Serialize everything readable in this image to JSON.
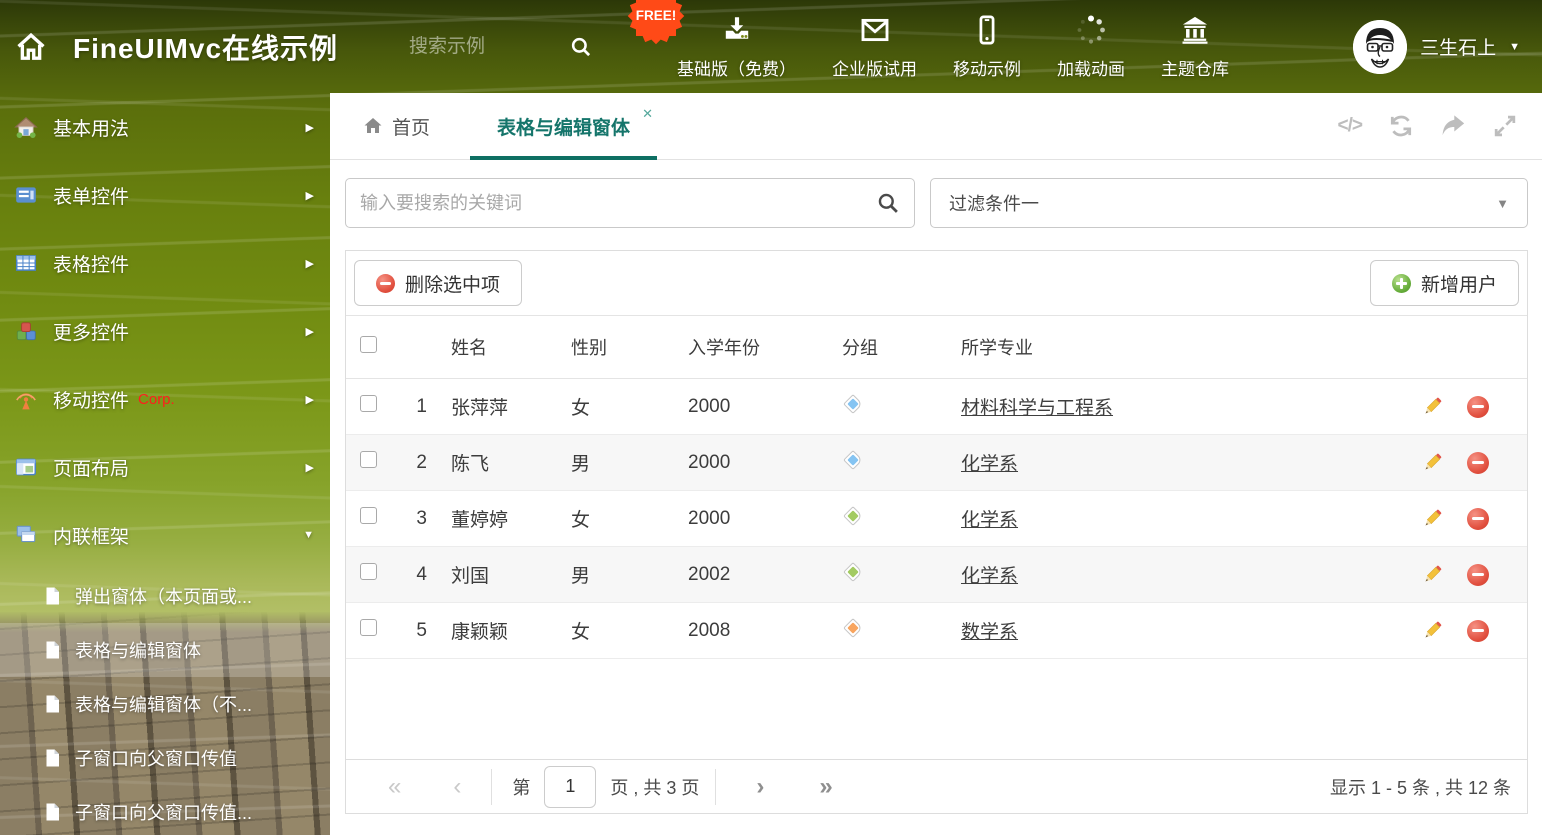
{
  "colors": {
    "accent_teal": "#15756b",
    "danger_red": "#e14f3e",
    "success_green": "#66ad3a",
    "badge_orange": "#ff4a17",
    "corp_red": "#ff1d1d"
  },
  "icons": {
    "caret_down": "▼",
    "arrow_right": "▶",
    "close": "✕",
    "code": "</>",
    "page_first": "«",
    "page_prev": "‹",
    "page_next": "›",
    "page_last": "»"
  },
  "header": {
    "title": "FineUIMvc在线示例",
    "search_placeholder": "搜索示例",
    "nav": [
      {
        "label": "基础版（免费）",
        "badge": "FREE!",
        "icon": "download-icon"
      },
      {
        "label": "企业版试用",
        "icon": "envelope-icon"
      },
      {
        "label": "移动示例",
        "icon": "mobile-icon"
      },
      {
        "label": "加载动画",
        "icon": "spinner-icon"
      },
      {
        "label": "主题仓库",
        "icon": "bank-icon"
      }
    ],
    "user_name": "三生石上"
  },
  "sidebar": {
    "items": [
      {
        "label": "基本用法",
        "icon": "home-icon"
      },
      {
        "label": "表单控件",
        "icon": "form-icon"
      },
      {
        "label": "表格控件",
        "icon": "grid-icon"
      },
      {
        "label": "更多控件",
        "icon": "cubes-icon"
      },
      {
        "label": "移动控件",
        "badge": "Corp.",
        "icon": "antenna-icon"
      },
      {
        "label": "页面布局",
        "icon": "layout-icon"
      },
      {
        "label": "内联框架",
        "icon": "frames-icon",
        "expanded": true
      }
    ],
    "subitems": [
      "弹出窗体（本页面或...",
      "表格与编辑窗体",
      "表格与编辑窗体（不...",
      "子窗口向父窗口传值",
      "子窗口向父窗口传值..."
    ]
  },
  "tabs": [
    {
      "label": "首页"
    },
    {
      "label": "表格与编辑窗体",
      "active": true
    }
  ],
  "filter_row": {
    "keyword_placeholder": "输入要搜索的关键词",
    "filter_value": "过滤条件一"
  },
  "grid": {
    "delete_button": "删除选中项",
    "add_button": "新增用户",
    "columns": [
      "姓名",
      "性别",
      "入学年份",
      "分组",
      "所学专业"
    ],
    "rows": [
      {
        "index": "1",
        "name": "张萍萍",
        "gender": "女",
        "year": "2000",
        "tag_color": "#85c4f2",
        "major": "材料科学与工程系"
      },
      {
        "index": "2",
        "name": "陈飞",
        "gender": "男",
        "year": "2000",
        "tag_color": "#85c4f2",
        "major": "化学系"
      },
      {
        "index": "3",
        "name": "董婷婷",
        "gender": "女",
        "year": "2000",
        "tag_color": "#a3cb62",
        "major": "化学系"
      },
      {
        "index": "4",
        "name": "刘国",
        "gender": "男",
        "year": "2002",
        "tag_color": "#a3cb62",
        "major": "化学系"
      },
      {
        "index": "5",
        "name": "康颖颖",
        "gender": "女",
        "year": "2008",
        "tag_color": "#f8a55f",
        "major": "数学系"
      }
    ]
  },
  "pagination": {
    "label_page": "第",
    "page": "1",
    "label_total": "页 , 共 3 页",
    "info": "显示 1 - 5 条 , 共 12 条"
  }
}
